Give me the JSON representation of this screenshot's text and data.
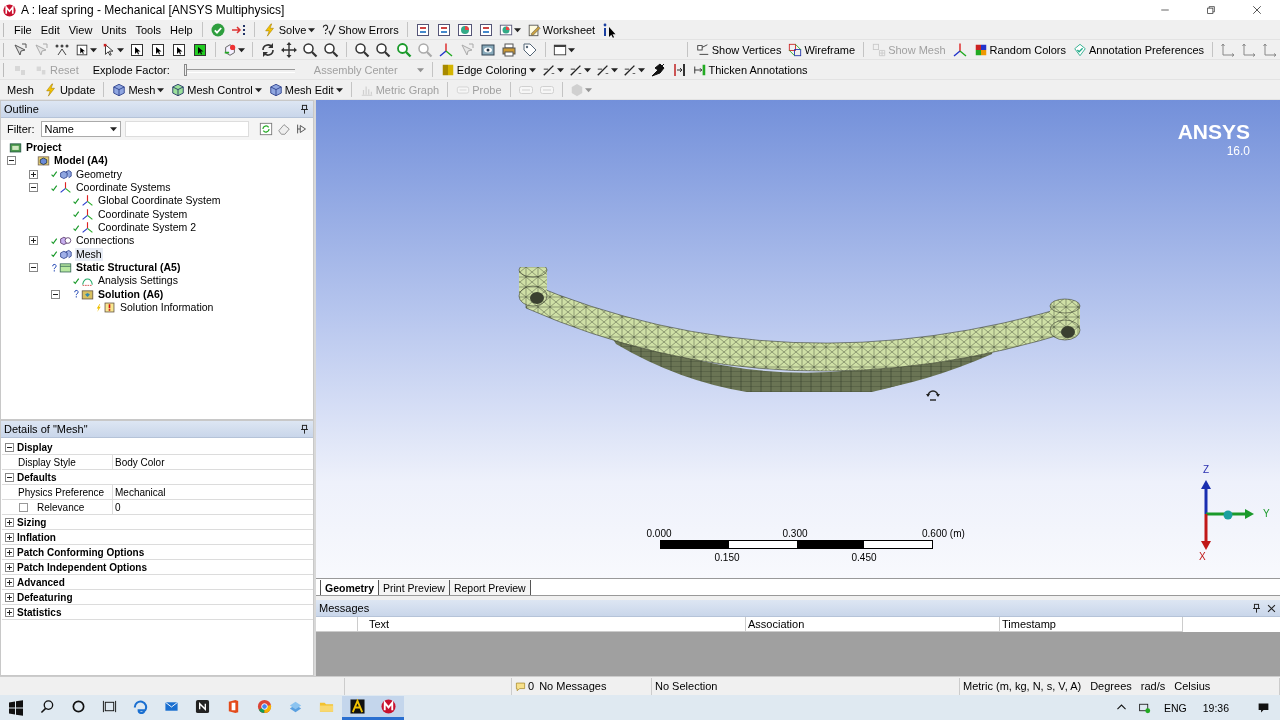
{
  "window": {
    "title": "A : leaf spring - Mechanical [ANSYS Multiphysics]"
  },
  "toolbars": {
    "standard": {
      "menu": [
        "File",
        "Edit",
        "View",
        "Units",
        "Tools",
        "Help"
      ],
      "buttons": [
        {
          "label": "Solve",
          "disabled": false
        },
        {
          "label": "Show Errors",
          "disabled": false
        },
        {
          "label": "Worksheet",
          "disabled": false
        }
      ]
    },
    "graphics": {
      "buttons": [
        {
          "label": "Show Vertices",
          "disabled": false
        },
        {
          "label": "Wireframe",
          "disabled": false
        },
        {
          "label": "Show Mesh",
          "disabled": true
        },
        {
          "label": "Random Colors",
          "disabled": false
        },
        {
          "label": "Annotation Preferences",
          "disabled": false
        }
      ]
    },
    "explode": {
      "buttons": [
        {
          "label": "Reset",
          "disabled": true
        },
        {
          "label": "Edge Coloring",
          "disabled": false
        },
        {
          "label": "Thicken Annotations",
          "disabled": false
        }
      ],
      "slider_label": "Explode Factor:",
      "level": 0,
      "center": {
        "value": "Assembly Center",
        "disabled": true
      }
    },
    "context": {
      "title": "Mesh",
      "buttons": [
        {
          "label": "Update",
          "disabled": false
        },
        {
          "label": "Mesh",
          "disabled": false
        },
        {
          "label": "Mesh Control",
          "disabled": false
        },
        {
          "label": "Mesh Edit",
          "disabled": false
        },
        {
          "label": "Metric Graph",
          "disabled": true
        },
        {
          "label": "Probe",
          "disabled": true
        }
      ]
    }
  },
  "outline": {
    "title": "Outline",
    "filter_label": "Filter:",
    "filter_value": "Name",
    "tree": [
      {
        "label": "Project",
        "kind": "project",
        "selected": false,
        "children": [
          {
            "label": "Model (A4)",
            "kind": "model",
            "expanded": true,
            "selected": false,
            "children": [
              {
                "label": "Geometry",
                "kind": "geometry",
                "status": {
                  "kind": "ok"
                },
                "expanded": false,
                "selected": false
              },
              {
                "label": "Coordinate Systems",
                "kind": "coordinates",
                "status": {
                  "kind": "ok"
                },
                "expanded": true,
                "selected": false,
                "children": [
                  {
                    "label": "Global Coordinate System",
                    "kind": "coordinate",
                    "status": {
                      "kind": "ok"
                    },
                    "selected": false
                  },
                  {
                    "label": "Coordinate System",
                    "kind": "coordinate",
                    "status": {
                      "kind": "ok"
                    },
                    "selected": false
                  },
                  {
                    "label": "Coordinate System 2",
                    "kind": "coordinate",
                    "status": {
                      "kind": "ok"
                    },
                    "selected": false
                  }
                ]
              },
              {
                "label": "Connections",
                "kind": "connections",
                "status": {
                  "kind": "ok"
                },
                "expanded": false,
                "selected": false
              },
              {
                "label": "Mesh",
                "kind": "mesh",
                "status": {
                  "kind": "ok"
                },
                "selected": true
              },
              {
                "label": "Static Structural (A5)",
                "kind": "analysis",
                "status": {
                  "kind": "unknown"
                },
                "expanded": true,
                "selected": false,
                "children": [
                  {
                    "label": "Analysis Settings",
                    "kind": "settings",
                    "status": {
                      "kind": "ok"
                    },
                    "selected": false
                  },
                  {
                    "label": "Solution (A6)",
                    "kind": "solution",
                    "status": {
                      "kind": "unknown"
                    },
                    "expanded": true,
                    "selected": false,
                    "children": [
                      {
                        "label": "Solution Information",
                        "kind": "info",
                        "status": {
                          "kind": "pending"
                        },
                        "selected": false
                      }
                    ]
                  }
                ]
              }
            ]
          }
        ]
      }
    ]
  },
  "details": {
    "title": "Details of \"Mesh\"",
    "groups": [
      {
        "label": "Display",
        "expanded": true,
        "rows": [
          {
            "name": "Display Style",
            "value": "Body Color"
          }
        ]
      },
      {
        "label": "Defaults",
        "expanded": true,
        "rows": [
          {
            "name": "Physics Preference",
            "value": "Mechanical"
          },
          {
            "name": "Relevance",
            "value": "0",
            "checked": false
          }
        ]
      },
      {
        "label": "Sizing",
        "expanded": false
      },
      {
        "label": "Inflation",
        "expanded": false
      },
      {
        "label": "Patch Conforming Options",
        "expanded": false
      },
      {
        "label": "Patch Independent Options",
        "expanded": false
      },
      {
        "label": "Advanced",
        "expanded": false
      },
      {
        "label": "Defeaturing",
        "expanded": false
      },
      {
        "label": "Statistics",
        "expanded": false
      }
    ]
  },
  "viewport": {
    "logo": "ANSYS",
    "version": "16.0",
    "scale": {
      "top_labels": [
        "0.000",
        "0.300",
        "0.600 (m)"
      ],
      "bottom_labels": [
        "0.150",
        "0.450"
      ]
    },
    "triad": {
      "z": "Z",
      "y": "Y",
      "x": "X"
    }
  },
  "view_tabs": [
    {
      "label": "Geometry",
      "selected": true
    },
    {
      "label": "Print Preview",
      "selected": false
    },
    {
      "label": "Report Preview",
      "selected": false
    }
  ],
  "messages": {
    "title": "Messages",
    "columns": [
      "Text",
      "Association",
      "Timestamp"
    ]
  },
  "status_bar": {
    "message_count": "0",
    "messages": "No Messages",
    "selection": "No Selection",
    "units": [
      "Metric (m, kg, N, s, V, A)",
      "Degrees",
      "rad/s",
      "Celsius"
    ]
  },
  "taskbar": {
    "apps": [
      {
        "running": false
      },
      {
        "running": false
      },
      {
        "running": false
      },
      {
        "running": false
      },
      {
        "running": false
      },
      {
        "running": false
      },
      {
        "running": false
      },
      {
        "running": true
      },
      {
        "running": true
      }
    ],
    "language": "ENG",
    "time": "19:36"
  }
}
